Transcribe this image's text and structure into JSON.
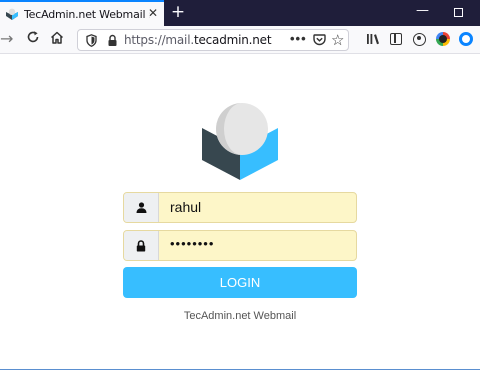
{
  "browser": {
    "tab_title": "TecAdmin.net Webmail :: Welcome to TecAdmin.net Webmail",
    "tab_close_glyph": "✕",
    "newtab_glyph": "+",
    "minimize_glyph": "—",
    "url_prefix": "https://mail.",
    "url_domain": "tecadmin.net",
    "more_glyph": "•••",
    "star_glyph": "☆",
    "back_glyph": "→"
  },
  "login": {
    "username_value": "rahul",
    "password_value": "••••••••",
    "button_label": "LOGIN",
    "footer": "TecAdmin.net Webmail"
  },
  "colors": {
    "accent": "#37beff",
    "field_bg": "#fdf6c8",
    "tabstrip": "#1f1e3a",
    "logo_dark": "#37474f",
    "logo_blue": "#37beff"
  },
  "icons": {
    "username": "user-icon",
    "password": "lock-icon",
    "logo": "roundcube-logo"
  }
}
